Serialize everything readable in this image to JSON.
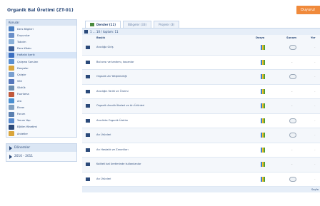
{
  "app": {
    "title": "Organik Bal Üretimi (ZT-01)",
    "header_button": "Duyurul"
  },
  "sidebar": {
    "menu_title": "Konular",
    "items": [
      {
        "label": "Ders Bilgileri",
        "icon": "info-icon",
        "color": "#4a7fc1"
      },
      {
        "label": "Duyurular",
        "icon": "megaphone-icon",
        "color": "#6a8fc8"
      },
      {
        "label": "Takvim",
        "icon": "calendar-icon",
        "color": "#8ab0d8"
      },
      {
        "label": "Ders Kitabı",
        "icon": "book-icon",
        "color": "#3b5f99"
      },
      {
        "label": "Haftalık İçerik",
        "icon": "week-content-icon",
        "color": "#3b6fc1",
        "active": true
      },
      {
        "label": "Çalışma Soruları",
        "icon": "questions-icon",
        "color": "#5a8fd0"
      },
      {
        "label": "Dosyalar",
        "icon": "folder-icon",
        "color": "#d9a53b"
      },
      {
        "label": "Çalıştır",
        "icon": "run-icon",
        "color": "#7aa0d0"
      },
      {
        "label": "SSS",
        "icon": "faq-icon",
        "color": "#5577bb"
      },
      {
        "label": "Sözlük",
        "icon": "dictionary-icon",
        "color": "#6b8db0"
      },
      {
        "label": "Fuarlama",
        "icon": "chart-icon",
        "color": "#c0583b"
      },
      {
        "label": "Ara",
        "icon": "search-icon",
        "color": "#4a8fd0"
      },
      {
        "label": "Ekran",
        "icon": "screen-icon",
        "color": "#7f9fc0"
      },
      {
        "label": "Forum",
        "icon": "forum-icon",
        "color": "#5a7fb0"
      },
      {
        "label": "Yorum Yap",
        "icon": "comment-icon",
        "color": "#5588cc"
      },
      {
        "label": "Eğitim Yönetimi",
        "icon": "admin-icon",
        "color": "#2b4a7a"
      },
      {
        "label": "Anketler",
        "icon": "survey-icon",
        "color": "#d9a53b"
      }
    ],
    "period_panel": {
      "title": "Dönemler",
      "item": "2010 - 2011"
    }
  },
  "main": {
    "tabs": [
      {
        "label": "Dersler (11)",
        "active": true
      },
      {
        "label": "Bölgeler (33)",
        "active": false
      },
      {
        "label": "Projeler (3)",
        "active": false
      }
    ],
    "list_info": "1 ... 10 / toplam: 11",
    "columns": [
      "Başlık",
      "Dosya",
      "Sunum",
      "Yor"
    ],
    "rows": [
      {
        "title": "Arıcılığa Giriş",
        "extra": "cloud"
      },
      {
        "title": "Bal arısı ve tanıtımı, kovanlar",
        "extra": "dash"
      },
      {
        "title": "Organik Arı Yetiştiriciliği",
        "extra": "cloud"
      },
      {
        "title": "Arıcılığın Tarihi ve Önemi",
        "extra": "dash"
      },
      {
        "title": "Organik Arıcılık İlkeleri ve Arı Ürünleri",
        "extra": "dash"
      },
      {
        "title": "Arıcılıkta Organik Üretim",
        "extra": "cloud"
      },
      {
        "title": "Arı Ürünleri",
        "extra": "cloud"
      },
      {
        "title": "Arı Hastalık ve Zararlıları",
        "extra": "dash"
      },
      {
        "title": "Kaliteli bal üretiminde kullanılanlar",
        "extra": "dash"
      },
      {
        "title": "Arı Ürünleri",
        "extra": "cloud"
      }
    ],
    "footer": "Sayfa"
  }
}
